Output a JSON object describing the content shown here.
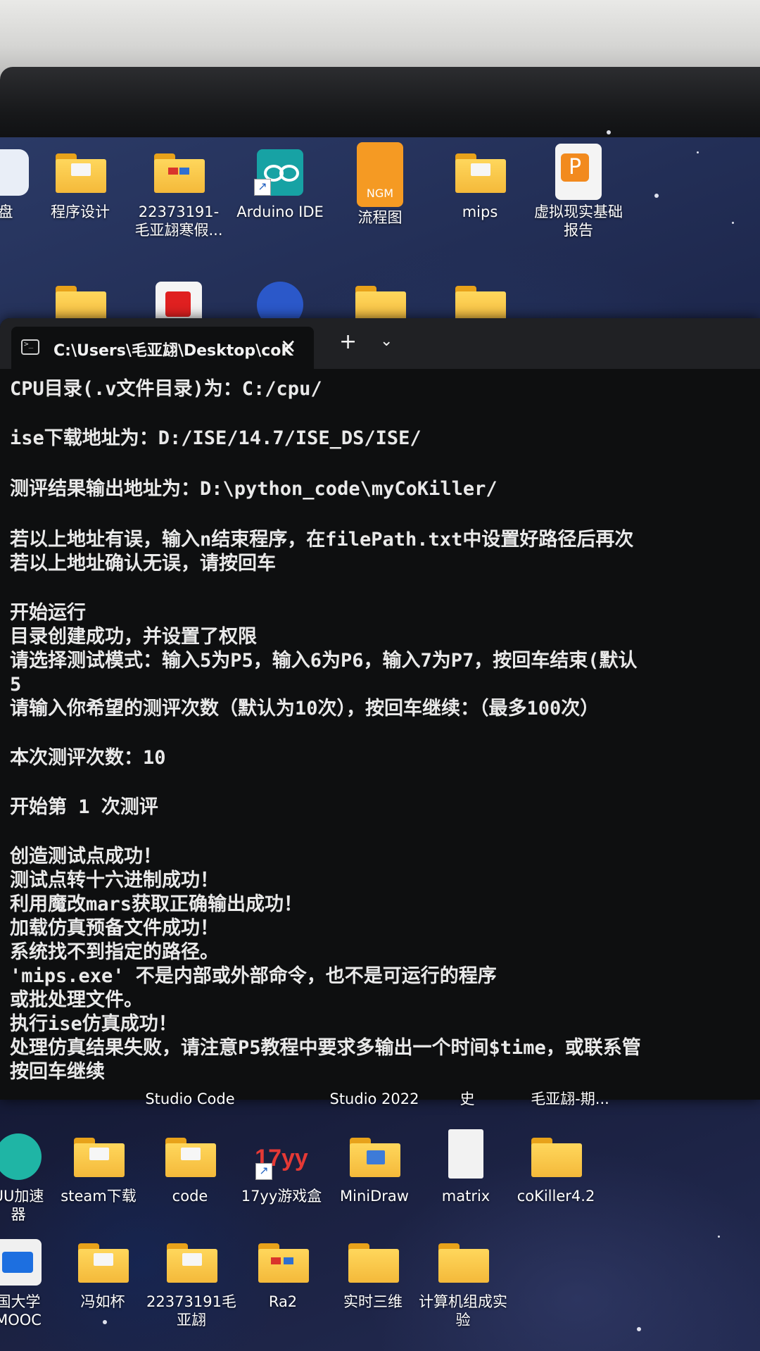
{
  "desktop_icons": [
    {
      "label": "盘"
    },
    {
      "label": "程序设计"
    },
    {
      "label": "22373191-\n毛亚翃寒假..."
    },
    {
      "label": "Arduino IDE"
    },
    {
      "label": "流程图"
    },
    {
      "label": "mips"
    },
    {
      "label": "虚拟现实基础\n报告"
    },
    {
      "label": "NGM"
    },
    {
      "label": "Studio Code"
    },
    {
      "label": "Studio 2022"
    },
    {
      "label": "史"
    },
    {
      "label": "毛亚翃-期..."
    },
    {
      "label": "UU加速\n器"
    },
    {
      "label": "steam下载"
    },
    {
      "label": "code"
    },
    {
      "label": "17yy游戏盒"
    },
    {
      "label": "MiniDraw"
    },
    {
      "label": "matrix"
    },
    {
      "label": "coKiller4.2"
    },
    {
      "label": "国大学\nMOOC"
    },
    {
      "label": "冯如杯"
    },
    {
      "label": "22373191毛\n亚翃"
    },
    {
      "label": "Ra2"
    },
    {
      "label": "实时三维"
    },
    {
      "label": "计算机组成实\n验"
    },
    {
      "label": "17yy"
    }
  ],
  "terminal": {
    "tab_title": "C:\\Users\\毛亚翃\\Desktop\\coK",
    "close_glyph": "✕",
    "new_tab_glyph": "+",
    "dropdown_glyph": "⌄",
    "lines": [
      "CPU目录(.v文件目录)为：C:/cpu/",
      "ise下载地址为：D:/ISE/14.7/ISE_DS/ISE/",
      "测评结果输出地址为：D:\\python_code\\myCoKiller/",
      "若以上地址有误，输入n结束程序，在filePath.txt中设置好路径后再次",
      "若以上地址确认无误，请按回车",
      "开始运行",
      "目录创建成功，并设置了权限",
      "请选择测试模式：输入5为P5，输入6为P6，输入7为P7，按回车结束(默认",
      "5",
      "请输入你希望的测评次数（默认为10次），按回车继续：（最多100次）",
      "本次测评次数：10",
      "开始第 1 次测评",
      "创造测试点成功！",
      "测试点转十六进制成功！",
      "利用魔改mars获取正确输出成功！",
      "加载仿真预备文件成功！",
      "系统找不到指定的路径。",
      "'mips.exe' 不是内部或外部命令，也不是可运行的程序",
      "或批处理文件。",
      "执行ise仿真成功！",
      "处理仿真结果失败，请注意P5教程中要求多输出一个时间$time，或联系管",
      "按回车继续"
    ]
  }
}
